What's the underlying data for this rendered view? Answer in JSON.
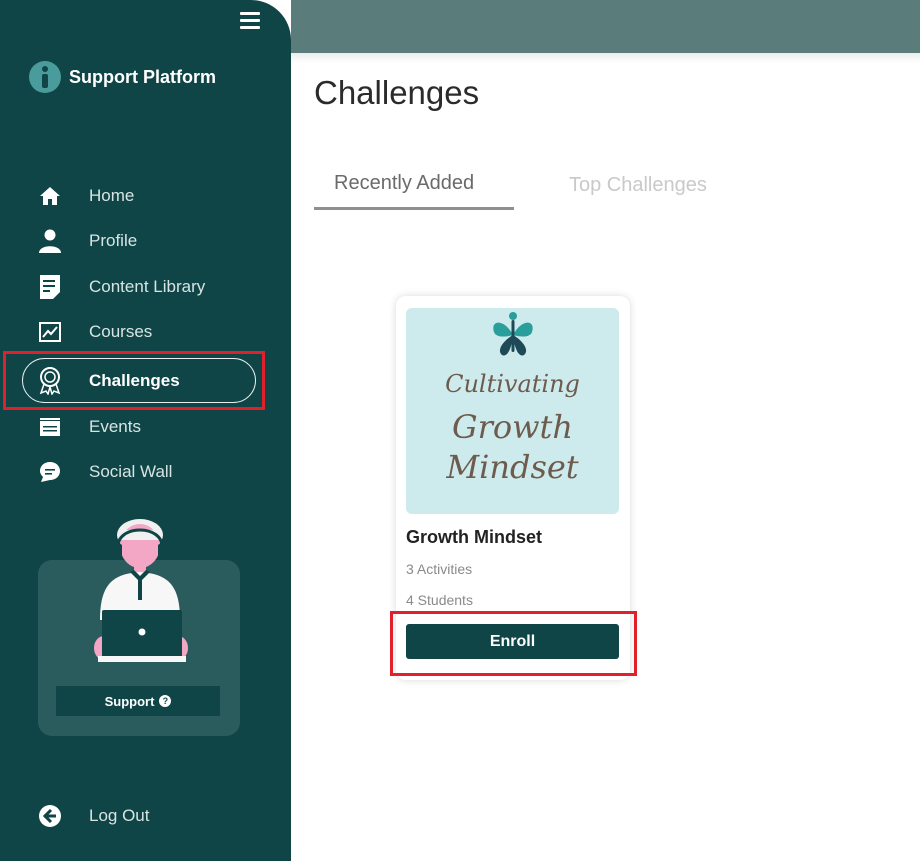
{
  "app": {
    "brand": "Support Platform"
  },
  "sidebar": {
    "items": [
      {
        "label": "Home",
        "icon": "home-icon"
      },
      {
        "label": "Profile",
        "icon": "user-icon"
      },
      {
        "label": "Content Library",
        "icon": "document-icon"
      },
      {
        "label": "Courses",
        "icon": "chart-board-icon"
      },
      {
        "label": "Challenges",
        "icon": "award-icon",
        "active": true
      },
      {
        "label": "Events",
        "icon": "calendar-icon"
      },
      {
        "label": "Social Wall",
        "icon": "chat-bubble-icon"
      }
    ],
    "support_label": "Support",
    "logout_label": "Log Out"
  },
  "page": {
    "title": "Challenges",
    "tabs": [
      {
        "label": "Recently Added",
        "active": true
      },
      {
        "label": "Top Challenges",
        "active": false
      }
    ]
  },
  "challenge_card": {
    "image_text": [
      "Cultivating",
      "Growth",
      "Mindset"
    ],
    "title": "Growth Mindset",
    "activities": "3 Activities",
    "students": "4 Students",
    "button_label": "Enroll"
  },
  "colors": {
    "sidebar": "#0f4547",
    "topbar": "#5a7c7a",
    "accent": "#0f4547",
    "highlight": "#e0202b",
    "card_image_bg": "#cdeaec"
  }
}
